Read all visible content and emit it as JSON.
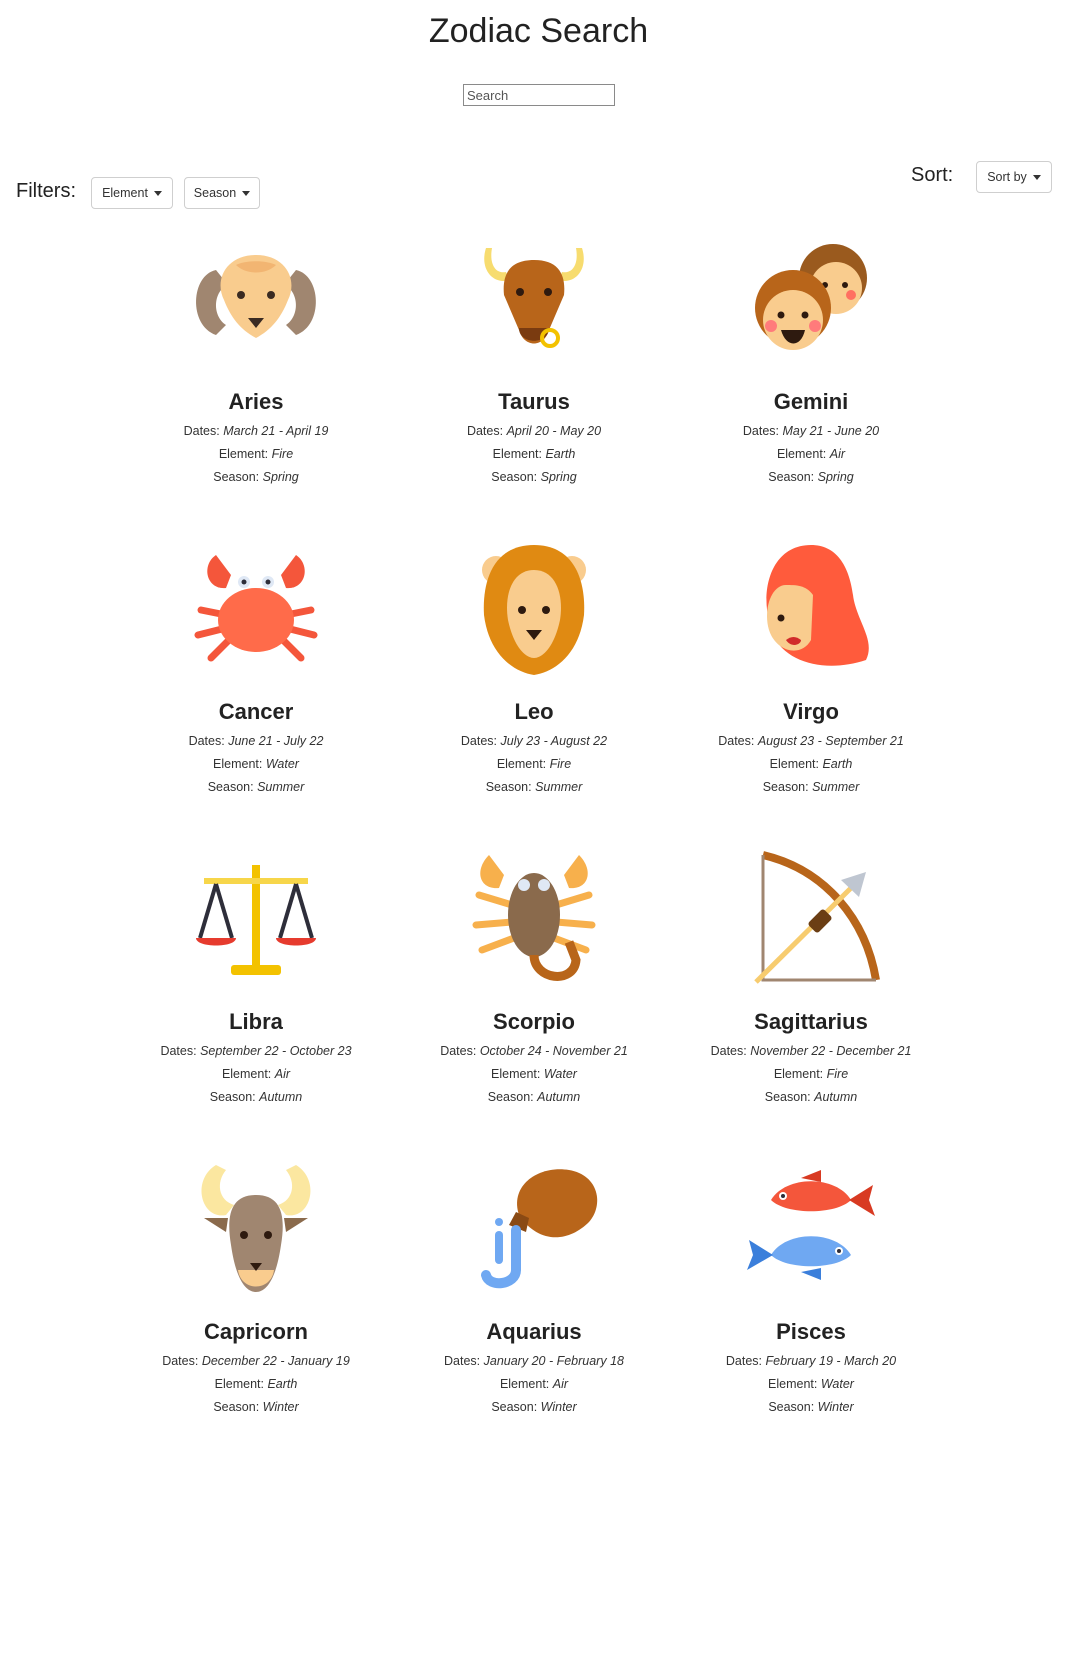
{
  "title": "Zodiac Search",
  "search": {
    "placeholder": "Search"
  },
  "filters": {
    "label": "Filters:",
    "element_label": "Element",
    "season_label": "Season"
  },
  "sort": {
    "label": "Sort:",
    "button_label": "Sort by"
  },
  "labels": {
    "dates": "Dates:",
    "element": "Element:",
    "season": "Season:"
  },
  "signs": [
    {
      "name": "Aries",
      "dates": "March 21 - April 19",
      "element": "Fire",
      "season": "Spring",
      "icon": "ram-icon"
    },
    {
      "name": "Taurus",
      "dates": "April 20 - May 20",
      "element": "Earth",
      "season": "Spring",
      "icon": "bull-icon"
    },
    {
      "name": "Gemini",
      "dates": "May 21 - June 20",
      "element": "Air",
      "season": "Spring",
      "icon": "twins-icon"
    },
    {
      "name": "Cancer",
      "dates": "June 21 - July 22",
      "element": "Water",
      "season": "Summer",
      "icon": "crab-icon"
    },
    {
      "name": "Leo",
      "dates": "July 23 - August 22",
      "element": "Fire",
      "season": "Summer",
      "icon": "lion-icon"
    },
    {
      "name": "Virgo",
      "dates": "August 23 - September 21",
      "element": "Earth",
      "season": "Summer",
      "icon": "maiden-icon"
    },
    {
      "name": "Libra",
      "dates": "September 22 - October 23",
      "element": "Air",
      "season": "Autumn",
      "icon": "scales-icon"
    },
    {
      "name": "Scorpio",
      "dates": "October 24 - November 21",
      "element": "Water",
      "season": "Autumn",
      "icon": "scorpion-icon"
    },
    {
      "name": "Sagittarius",
      "dates": "November 22 - December 21",
      "element": "Fire",
      "season": "Autumn",
      "icon": "bow-arrow-icon"
    },
    {
      "name": "Capricorn",
      "dates": "December 22 - January 19",
      "element": "Earth",
      "season": "Winter",
      "icon": "goat-icon"
    },
    {
      "name": "Aquarius",
      "dates": "January 20 - February 18",
      "element": "Air",
      "season": "Winter",
      "icon": "water-jar-icon"
    },
    {
      "name": "Pisces",
      "dates": "February 19 - March 20",
      "element": "Water",
      "season": "Winter",
      "icon": "fish-icon"
    }
  ]
}
